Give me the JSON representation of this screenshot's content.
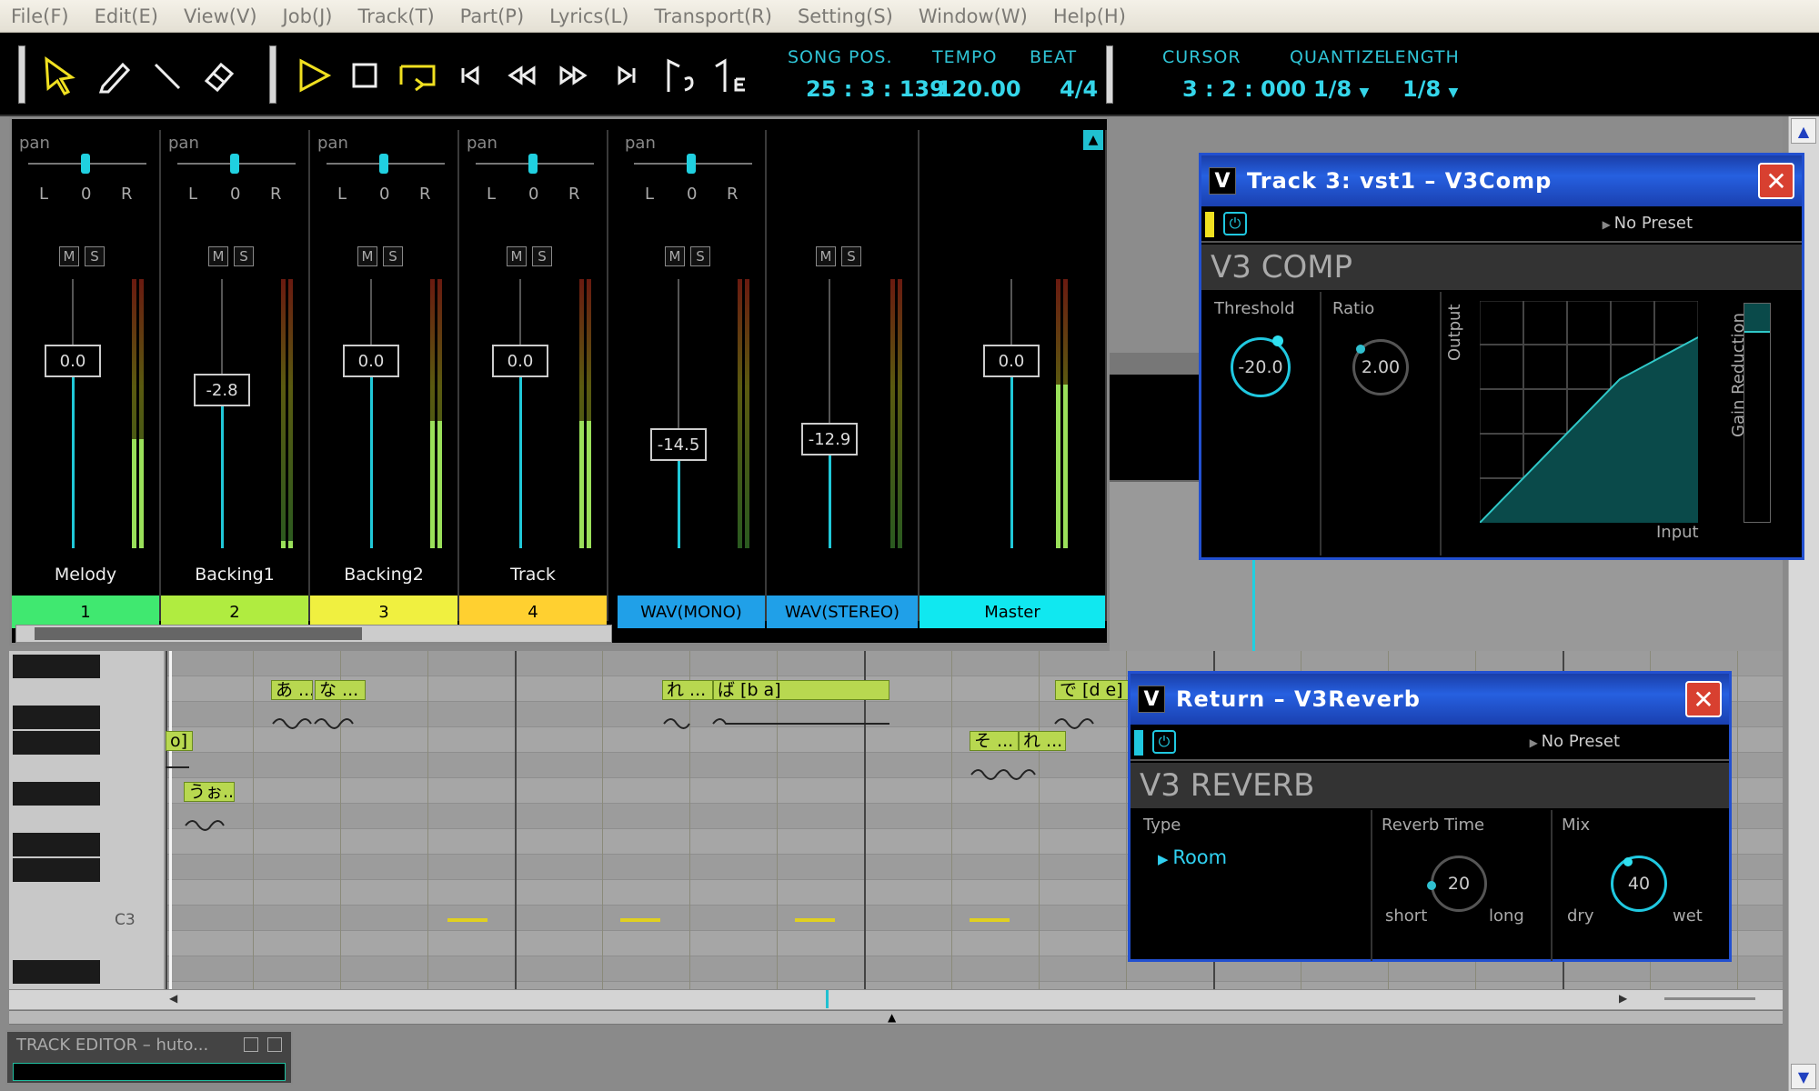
{
  "menu": [
    "File(F)",
    "Edit(E)",
    "View(V)",
    "Job(J)",
    "Track(T)",
    "Part(P)",
    "Lyrics(L)",
    "Transport(R)",
    "Setting(S)",
    "Window(W)",
    "Help(H)"
  ],
  "transport": {
    "song_pos_label": "SONG POS.",
    "song_pos": "25 : 3 : 139",
    "tempo_label": "TEMPO",
    "tempo": "120.00",
    "beat_label": "BEAT",
    "beat": "4/4",
    "cursor_label": "CURSOR",
    "cursor": "3 : 2 : 000",
    "quantize_label": "QUANTIZE",
    "quantize": "1/8",
    "length_label": "LENGTH",
    "length": "1/8"
  },
  "mixer": {
    "pan_label": "pan",
    "pan_l": "L",
    "pan_c": "0",
    "pan_r": "R",
    "mute": "M",
    "solo": "S",
    "channels": [
      {
        "name": "Melody",
        "number": "1",
        "fader": "0.0",
        "color": "#40e870"
      },
      {
        "name": "Backing1",
        "number": "2",
        "fader": "-2.8",
        "color": "#b0ec40"
      },
      {
        "name": "Backing2",
        "number": "3",
        "fader": "0.0",
        "color": "#f0f040"
      },
      {
        "name": "Track",
        "number": "4",
        "fader": "0.0",
        "color": "#ffd030"
      },
      {
        "name": "",
        "number": "WAV(MONO)",
        "fader": "-14.5",
        "color": "#20a0e8"
      },
      {
        "name": "",
        "number": "WAV(STEREO)",
        "fader": "-12.9",
        "color": "#20a0e8"
      },
      {
        "name": "",
        "number": "Master",
        "fader": "0.0",
        "color": "#10e8f0"
      }
    ]
  },
  "piano_roll": {
    "c3_label": "C3",
    "notes": [
      "あ ...",
      "な ...",
      "れ ...",
      "ば [b a]",
      "で [d e]",
      "o]",
      "そ ...",
      "れ ...",
      "うぉ..."
    ]
  },
  "comp": {
    "title": "Track 3: vst1 – V3Comp",
    "preset": "No Preset",
    "header": "V3 COMP",
    "threshold_label": "Threshold",
    "threshold": "-20.0",
    "ratio_label": "Ratio",
    "ratio": "2.00",
    "output_label": "Output",
    "input_label": "Input",
    "gr_label": "Gain Reduction"
  },
  "reverb": {
    "title": "Return – V3Reverb",
    "preset": "No Preset",
    "header": "V3 REVERB",
    "type_label": "Type",
    "type_value": "Room",
    "time_label": "Reverb Time",
    "time": "20",
    "short": "short",
    "long": "long",
    "mix_label": "Mix",
    "mix": "40",
    "dry": "dry",
    "wet": "wet"
  },
  "track_editor": {
    "title": "TRACK EDITOR – huto..."
  }
}
